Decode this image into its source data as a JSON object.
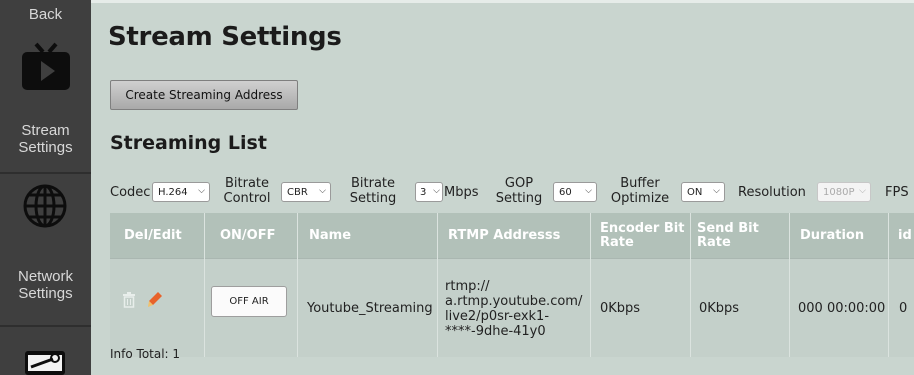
{
  "sidebar": {
    "back_label": "Back",
    "items": [
      {
        "label_line1": "Stream",
        "label_line2": "Settings",
        "icon": "tv-play-icon"
      },
      {
        "label_line1": "Network",
        "label_line2": "Settings",
        "icon": "globe-icon"
      },
      {
        "icon": "tool-icon"
      }
    ]
  },
  "page": {
    "title": "Stream Settings",
    "create_button": "Create Streaming Address",
    "list_title": "Streaming List",
    "info_total": "Info Total: 1"
  },
  "controls": {
    "codec": {
      "label": "Codec",
      "value": "H.264"
    },
    "bitrate_control": {
      "label_line1": "Bitrate",
      "label_line2": "Control",
      "value": "CBR"
    },
    "bitrate_setting": {
      "label_line1": "Bitrate",
      "label_line2": "Setting",
      "value": "3",
      "unit": "Mbps"
    },
    "gop_setting": {
      "label_line1": "GOP",
      "label_line2": "Setting",
      "value": "60"
    },
    "buffer_optimize": {
      "label_line1": "Buffer",
      "label_line2": "Optimize",
      "value": "ON"
    },
    "resolution": {
      "label": "Resolution",
      "value": "1080P"
    },
    "fps": {
      "label": "FPS"
    }
  },
  "table": {
    "headers": {
      "del_edit": "Del/Edit",
      "on_off": "ON/OFF",
      "name": "Name",
      "rtmp": "RTMP Addresss",
      "encoder_line1": "Encoder Bit",
      "encoder_line2": "Rate",
      "send_line1": "Send Bit",
      "send_line2": "Rate",
      "duration": "Duration",
      "id": "id"
    },
    "rows": [
      {
        "on_off_button": "OFF AIR",
        "name": "Youtube_Streaming",
        "rtmp_line1": "rtmp://",
        "rtmp_line2": "a.rtmp.youtube.com/",
        "rtmp_line3": "live2/p0sr-exk1-",
        "rtmp_line4": "****-9dhe-41y0",
        "encoder_bit_rate": "0Kbps",
        "send_bit_rate": "0Kbps",
        "duration": "000 00:00:00",
        "id": "0"
      }
    ]
  },
  "colors": {
    "sidebar_bg": "#3f3f3f",
    "page_bg": "#c9d5cf",
    "table_header_bg": "#b2c1b9",
    "edit_icon": "#e8622a"
  }
}
